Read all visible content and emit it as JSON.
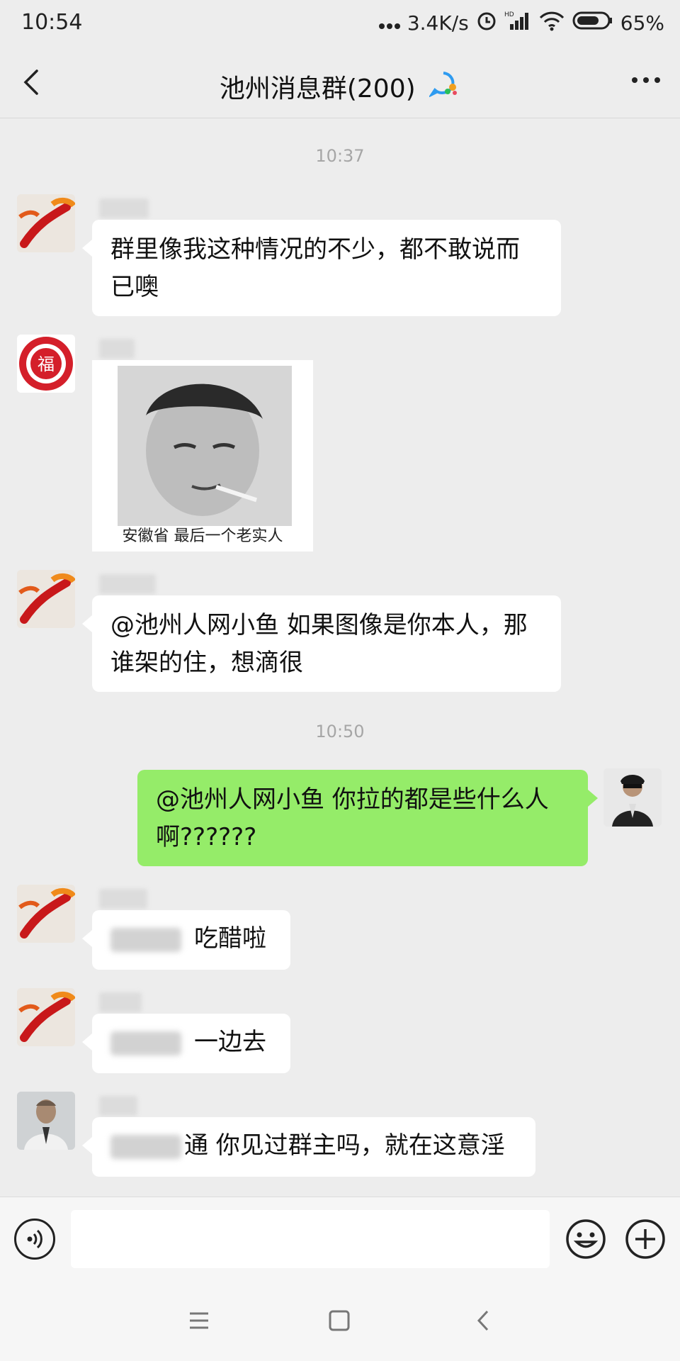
{
  "status_bar": {
    "time": "10:54",
    "net_speed": "3.4K/s",
    "battery": "65%"
  },
  "header": {
    "title": "池州消息群(200)"
  },
  "messages": [
    {
      "type": "time",
      "text": "10:37"
    },
    {
      "type": "text",
      "side": "left",
      "text": "群里像我这种情况的不少，都不敢说而已噢"
    },
    {
      "type": "sticker",
      "side": "left",
      "caption": "安徽省 最后一个老实人"
    },
    {
      "type": "text",
      "side": "left",
      "text": "@池州人网小鱼  如果图像是你本人，那谁架的住，想滴很"
    },
    {
      "type": "time",
      "text": "10:50"
    },
    {
      "type": "text",
      "side": "right",
      "text": "@池州人网小鱼  你拉的都是些什么人啊??????"
    },
    {
      "type": "text",
      "side": "left",
      "text": "吃醋啦"
    },
    {
      "type": "text",
      "side": "left",
      "text": "一边去"
    },
    {
      "type": "text",
      "side": "left",
      "text": "通  你见过群主吗，就在这意淫"
    }
  ],
  "input": {
    "placeholder": ""
  },
  "icons": {
    "back": "chevron-left-icon",
    "group": "group-chat-icon",
    "more": "more-dots-icon",
    "voice": "voice-icon",
    "emoji": "emoji-icon",
    "plus": "plus-icon"
  },
  "colors": {
    "background": "#ededed",
    "bubble_me": "#95ec69",
    "bubble_other": "#ffffff",
    "time_text": "#a6a6a6"
  }
}
